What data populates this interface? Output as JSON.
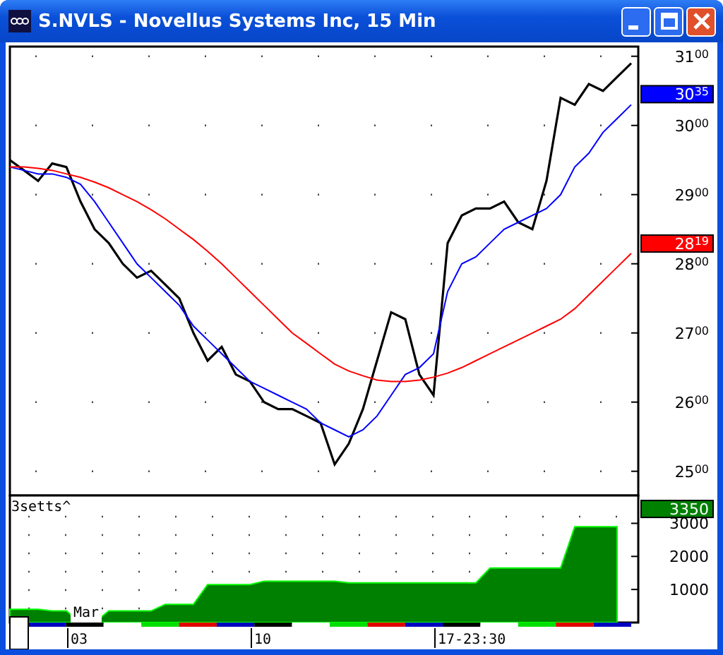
{
  "window": {
    "title": "S.NVLS - Novellus Systems Inc, 15 Min"
  },
  "price_panel": {
    "chart_data": {
      "type": "line",
      "categories": [
        null,
        null,
        null,
        null,
        null,
        null,
        null,
        null,
        null,
        null,
        null,
        null,
        null,
        null,
        null,
        null,
        null,
        null,
        null,
        null,
        null,
        null,
        null,
        null,
        null,
        null,
        null,
        null,
        null,
        null,
        null,
        null,
        null,
        null,
        null,
        null,
        null,
        null,
        null,
        null,
        null,
        null,
        null,
        null,
        null
      ],
      "ylim": [
        2465,
        3114
      ],
      "yticks": [
        3100,
        3000,
        2900,
        2800,
        2700,
        2600,
        2500
      ],
      "grid": true,
      "series": [
        {
          "color": "#000000",
          "values": [
            2950,
            2935,
            2920,
            2945,
            2940,
            2890,
            2850,
            2830,
            2800,
            2780,
            2790,
            2770,
            2750,
            2700,
            2660,
            2680,
            2640,
            2630,
            2600,
            2590,
            2590,
            2580,
            2570,
            2510,
            2540,
            2590,
            2660,
            2730,
            2720,
            2640,
            2610,
            2830,
            2870,
            2880,
            2880,
            2890,
            2860,
            2850,
            2920,
            3040,
            3030,
            3060,
            3050,
            3070,
            3090
          ]
        },
        {
          "color": "#0000ff",
          "values": [
            2940,
            2935,
            2930,
            2930,
            2925,
            2915,
            2890,
            2860,
            2830,
            2800,
            2780,
            2760,
            2740,
            2710,
            2690,
            2670,
            2650,
            2630,
            2620,
            2610,
            2600,
            2590,
            2570,
            2560,
            2550,
            2560,
            2580,
            2610,
            2640,
            2650,
            2670,
            2760,
            2800,
            2810,
            2830,
            2850,
            2860,
            2870,
            2880,
            2900,
            2940,
            2960,
            2990,
            3010,
            3030
          ]
        },
        {
          "color": "#ff0000",
          "values": [
            2940,
            2940,
            2938,
            2935,
            2930,
            2925,
            2918,
            2910,
            2900,
            2890,
            2878,
            2865,
            2850,
            2835,
            2818,
            2800,
            2780,
            2760,
            2740,
            2720,
            2700,
            2685,
            2670,
            2655,
            2645,
            2638,
            2632,
            2630,
            2630,
            2632,
            2636,
            2642,
            2650,
            2660,
            2670,
            2680,
            2690,
            2700,
            2710,
            2720,
            2735,
            2755,
            2775,
            2795,
            2815
          ]
        }
      ]
    },
    "badges": [
      {
        "text": "30$^{35}$",
        "color": "#0000ff"
      },
      {
        "text": "28$^{19}$",
        "color": "#ff0000"
      }
    ]
  },
  "volume_panel": {
    "title": "3setts^",
    "chart_data": {
      "type": "area",
      "categories": [
        null,
        null,
        null,
        null,
        null,
        null,
        null,
        null,
        null,
        null,
        null,
        null,
        null,
        null,
        null,
        null,
        null,
        null,
        null,
        null,
        null,
        null,
        null,
        null,
        null,
        null,
        null,
        null,
        null,
        null,
        null,
        null,
        null,
        null,
        null,
        null,
        null,
        null,
        null,
        null,
        null,
        null,
        null,
        null
      ],
      "ylim": [
        0,
        3800
      ],
      "yticks": [
        1000,
        2000,
        3000
      ],
      "grid": true,
      "series": [
        {
          "color": "#008000",
          "values": [
            400,
            400,
            400,
            350,
            350,
            0,
            0,
            350,
            350,
            350,
            350,
            550,
            550,
            550,
            1150,
            1150,
            1150,
            1150,
            1250,
            1250,
            1250,
            1250,
            1250,
            1250,
            1200,
            1200,
            1200,
            1200,
            1200,
            1200,
            1200,
            1200,
            1200,
            1200,
            1650,
            1650,
            1650,
            1650,
            1650,
            1650,
            2900,
            2900,
            2900,
            2900
          ]
        }
      ]
    },
    "badges": [
      {
        "text": "3350",
        "color": "#008000"
      }
    ]
  },
  "time_axis": {
    "labels": [
      {
        "text": "Mar",
        "kind": "month"
      },
      {
        "text": "03",
        "kind": "day"
      },
      {
        "text": "10",
        "kind": "day"
      },
      {
        "text": "17-23:30",
        "kind": "day"
      }
    ],
    "session_bar": [
      {
        "color": "#0000c0"
      },
      {
        "color": "#000000"
      },
      {
        "color": "#ffffff"
      },
      {
        "color": "#00e000"
      },
      {
        "color": "#e00000"
      },
      {
        "color": "#0000c0"
      },
      {
        "color": "#000000"
      },
      {
        "color": "#ffffff"
      },
      {
        "color": "#00e000"
      },
      {
        "color": "#e00000"
      },
      {
        "color": "#0000c0"
      },
      {
        "color": "#000000"
      },
      {
        "color": "#ffffff"
      },
      {
        "color": "#00e000"
      },
      {
        "color": "#e00000"
      },
      {
        "color": "#0000c0"
      }
    ]
  }
}
